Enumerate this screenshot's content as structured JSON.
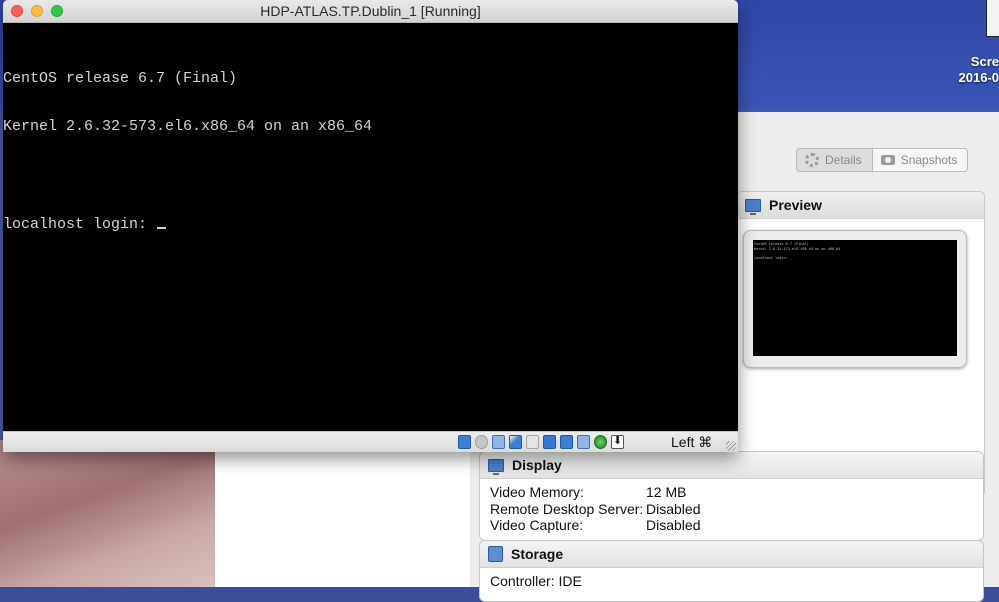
{
  "desktop": {
    "icon_label_line1": "Scre",
    "icon_label_line2": "2016-0"
  },
  "vm_window": {
    "title": "HDP-ATLAS.TP.Dublin_1 [Running]",
    "console_lines": [
      "CentOS release 6.7 (Final)",
      "Kernel 2.6.32-573.el6.x86_64 on an x86_64",
      "",
      "localhost login: "
    ],
    "status_icons": [
      "hard-disk-icon",
      "optical-drive-icon",
      "audio-icon",
      "network-pen-icon",
      "usb-icon",
      "display-icon",
      "shared-folders-icon",
      "video-capture-icon",
      "mouse-integration-icon",
      "download-icon"
    ],
    "host_key": "Left ⌘"
  },
  "manager": {
    "toggle": {
      "details_label": "Details",
      "snapshots_label": "Snapshots"
    },
    "preview": {
      "title": "Preview",
      "screen_text": "CentOS release 6.7 (Final)\nKernel 2.6.32-573.el6.x86_64 on an x86_64\n\nlocalhost login: _"
    },
    "display": {
      "title": "Display",
      "rows": [
        {
          "key": "Video Memory:",
          "value": "12 MB"
        },
        {
          "key": "Remote Desktop Server:",
          "value": "Disabled"
        },
        {
          "key": "Video Capture:",
          "value": "Disabled"
        }
      ]
    },
    "storage": {
      "title": "Storage",
      "rows": [
        {
          "key": "Controller: IDE",
          "value": ""
        }
      ]
    }
  }
}
